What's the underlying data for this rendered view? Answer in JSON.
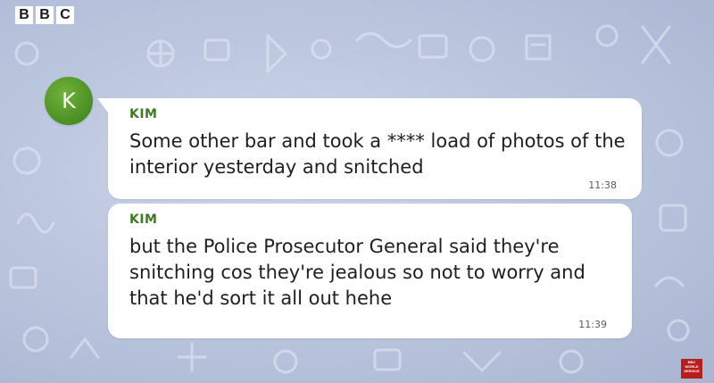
{
  "brand": {
    "letters": [
      "B",
      "B",
      "C"
    ],
    "world_service_lines": [
      "BBC",
      "WORLD",
      "SERVICE"
    ]
  },
  "contact": {
    "avatar_initial": "K"
  },
  "messages": [
    {
      "sender": "KIM",
      "text": "Some other bar and took a **** load of photos of the interior yesterday and snitched",
      "time": "11:38"
    },
    {
      "sender": "KIM",
      "text": "but the Police Prosecutor General said they're snitching cos they're jealous so not to worry and that he'd sort it all out hehe",
      "time": "11:39"
    }
  ],
  "colors": {
    "accent_green": "#3e7a1f",
    "avatar_green": "#4a8f23",
    "bubble": "#ffffff",
    "background": "#bcc7df",
    "bbc_red": "#b81d1d"
  }
}
